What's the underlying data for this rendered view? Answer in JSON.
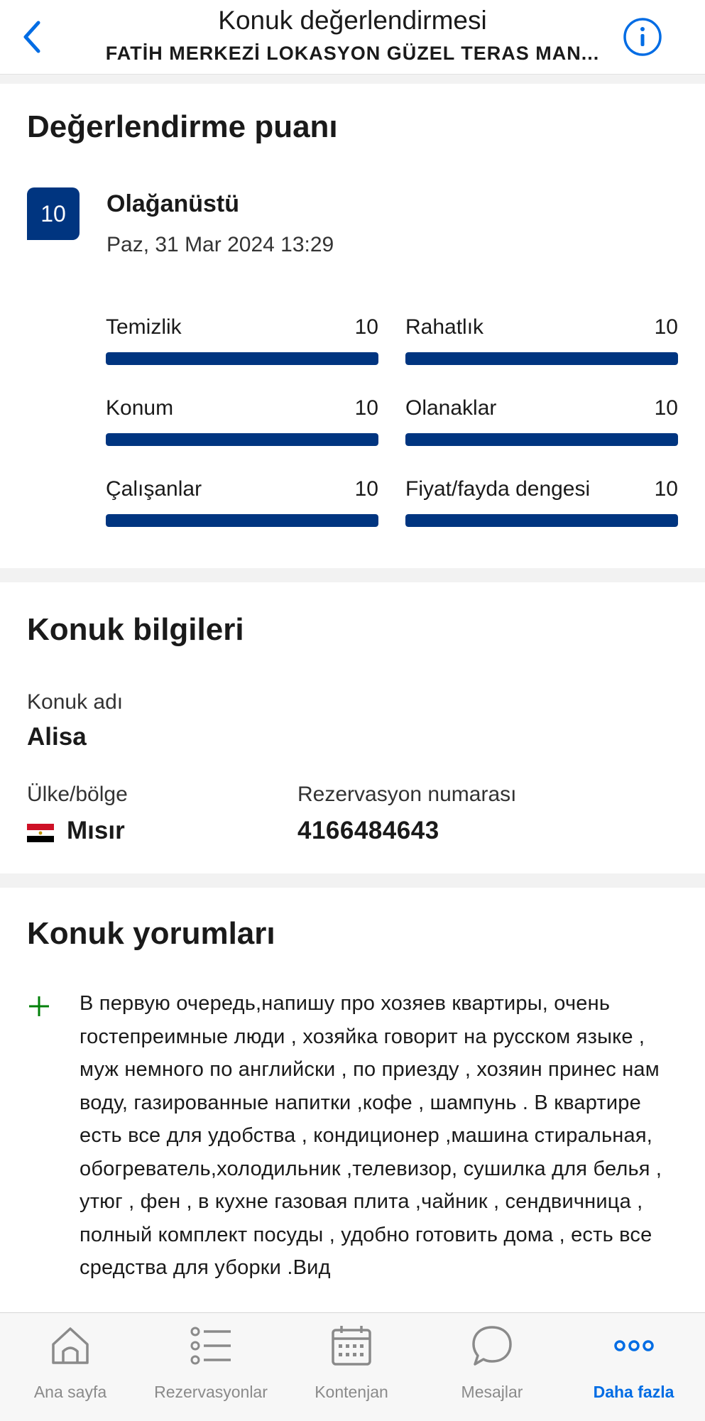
{
  "header": {
    "title": "Konuk değerlendirmesi",
    "subtitle": "FATİH MERKEZİ LOKASYON GÜZEL TERAS MAN..."
  },
  "score": {
    "heading": "Değerlendirme puanı",
    "overall": "10",
    "label": "Olağanüstü",
    "date": "Paz, 31 Mar 2024 13:29",
    "max": 10,
    "categories": [
      {
        "name": "Temizlik",
        "value": "10",
        "fraction": 1.0
      },
      {
        "name": "Rahatlık",
        "value": "10",
        "fraction": 1.0
      },
      {
        "name": "Konum",
        "value": "10",
        "fraction": 1.0
      },
      {
        "name": "Olanaklar",
        "value": "10",
        "fraction": 1.0
      },
      {
        "name": "Çalışanlar",
        "value": "10",
        "fraction": 1.0
      },
      {
        "name": "Fiyat/fayda dengesi",
        "value": "10",
        "fraction": 1.0
      }
    ]
  },
  "guest": {
    "heading": "Konuk bilgileri",
    "name_label": "Konuk adı",
    "name": "Alisa",
    "country_label": "Ülke/bölge",
    "country": "Mısır",
    "reservation_label": "Rezervasyon numarası",
    "reservation_number": "4166484643"
  },
  "reviews": {
    "heading": "Konuk yorumları",
    "positive_icon": "plus-icon",
    "positive_text": "В первую очередь,напишу про хозяев квартиры, очень гостепреимные люди , хозяйка говорит на русском языке , муж немного по английски , по приезду , хозяин принес нам  воду, газированные напитки ,кофе , шампунь . В квартире есть все для удобства , кондиционер ,машина стиральная, обогреватель,холодильник ,телевизор, сушилка для белья , утюг , фен , в кухне газовая плита ,чайник , сендвичница , полный комплект посуды , удобно готовить дома , есть все средства для уборки .Вид"
  },
  "tabs": [
    {
      "label": "Ana sayfa",
      "icon": "home-icon"
    },
    {
      "label": "Rezervasyonlar",
      "icon": "list-icon"
    },
    {
      "label": "Kontenjan",
      "icon": "calendar-icon"
    },
    {
      "label": "Mesajlar",
      "icon": "chat-icon"
    },
    {
      "label": "Daha fazla",
      "icon": "more-icon"
    }
  ],
  "colors": {
    "brand": "#003580",
    "accent": "#006ce4",
    "positive": "#008009"
  }
}
